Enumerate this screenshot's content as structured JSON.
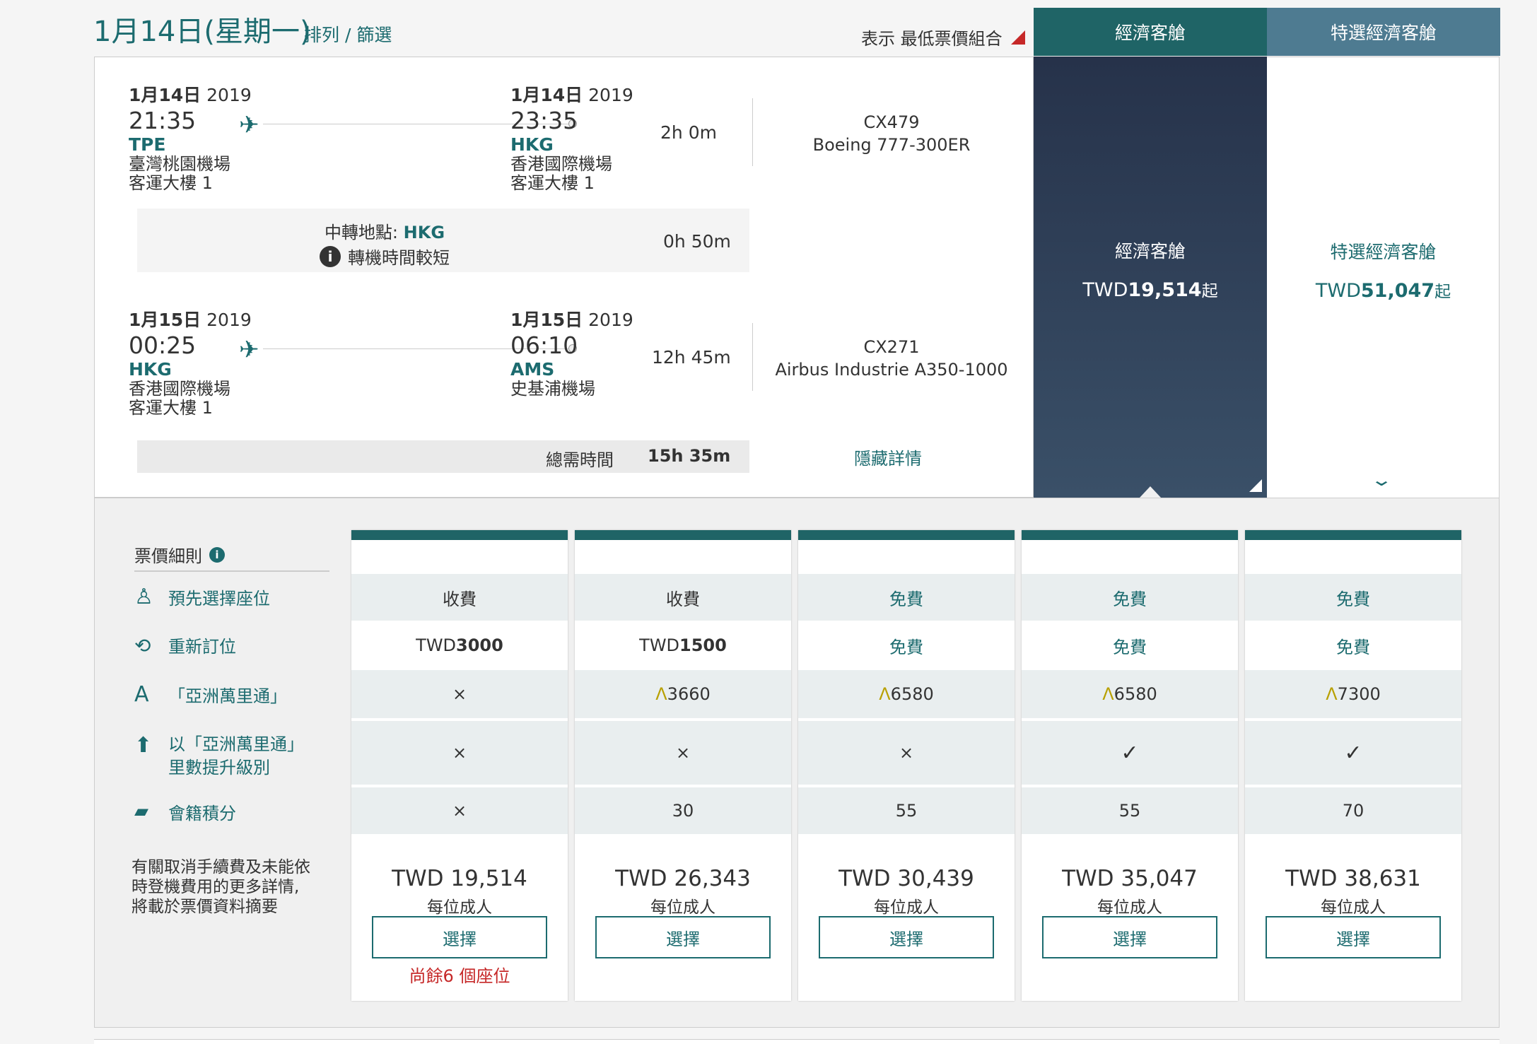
{
  "header": {
    "date_title": "1月14日(星期一)",
    "sort_filter": "排列 / 篩選",
    "lowest_combo": "表示 最低票價組合"
  },
  "cabin_tabs": [
    {
      "label": "經濟客艙"
    },
    {
      "label": "特選經濟客艙"
    }
  ],
  "segments": [
    {
      "dep": {
        "date_md": "1月14日",
        "year": "2019",
        "time": "21:35",
        "code": "TPE",
        "airport": "臺灣桃園機場",
        "terminal": "客運大樓 1"
      },
      "arr": {
        "date_md": "1月14日",
        "year": "2019",
        "time": "23:35",
        "code": "HKG",
        "airport": "香港國際機場",
        "terminal": "客運大樓 1"
      },
      "duration": "2h 0m",
      "flight_no": "CX479",
      "aircraft": "Boeing 777-300ER"
    },
    {
      "dep": {
        "date_md": "1月15日",
        "year": "2019",
        "time": "00:25",
        "code": "HKG",
        "airport": "香港國際機場",
        "terminal": "客運大樓 1"
      },
      "arr": {
        "date_md": "1月15日",
        "year": "2019",
        "time": "06:10",
        "code": "AMS",
        "airport": "史基浦機場",
        "terminal": ""
      },
      "duration": "12h 45m",
      "flight_no": "CX271",
      "aircraft": "Airbus Industrie A350-1000"
    }
  ],
  "transfer": {
    "label": "中轉地點:",
    "code": "HKG",
    "note": "轉機時間較短",
    "duration": "0h 50m"
  },
  "total": {
    "label": "總需時間",
    "value": "15h 35m"
  },
  "hide_details": "隱藏詳情",
  "cabin_prices": [
    {
      "name": "經濟客艙",
      "currency": "TWD",
      "amount": "19,514",
      "suffix": "起"
    },
    {
      "name": "特選經濟客艙",
      "currency": "TWD",
      "amount": "51,047",
      "suffix": "起"
    }
  ],
  "fare_rules": {
    "title": "票價細則",
    "rows": [
      {
        "label": "預先選擇座位",
        "icon": "seat-icon"
      },
      {
        "label": "重新訂位",
        "icon": "rebook-icon"
      },
      {
        "label": "「亞洲萬里通」",
        "icon": "asia-miles-icon"
      },
      {
        "label": "以「亞洲萬里通」",
        "label2": "里數提升級別",
        "icon": "upgrade-icon"
      },
      {
        "label": "會籍積分",
        "icon": "status-points-icon"
      }
    ],
    "note_lines": [
      "有關取消手續費及未能依",
      "時登機費用的更多詳情,",
      "將載於票價資料摘要"
    ]
  },
  "fares": [
    {
      "seat": "收費",
      "rebook_pre": "TWD",
      "rebook": "3000",
      "miles": "×",
      "miles_mark": "",
      "upgrade": "×",
      "points": "×",
      "price": "TWD 19,514",
      "per": "每位成人",
      "button": "選擇",
      "seats_left": "尚餘6 個座位"
    },
    {
      "seat": "收費",
      "rebook_pre": "TWD",
      "rebook": "1500",
      "miles": "3660",
      "miles_mark": "Λ",
      "upgrade": "×",
      "points": "30",
      "price": "TWD 26,343",
      "per": "每位成人",
      "button": "選擇",
      "seats_left": ""
    },
    {
      "seat": "免費",
      "rebook_pre": "",
      "rebook": "免費",
      "miles": "6580",
      "miles_mark": "Λ",
      "upgrade": "×",
      "points": "55",
      "price": "TWD 30,439",
      "per": "每位成人",
      "button": "選擇",
      "seats_left": ""
    },
    {
      "seat": "免費",
      "rebook_pre": "",
      "rebook": "免費",
      "miles": "6580",
      "miles_mark": "Λ",
      "upgrade": "✓",
      "points": "55",
      "price": "TWD 35,047",
      "per": "每位成人",
      "button": "選擇",
      "seats_left": ""
    },
    {
      "seat": "免費",
      "rebook_pre": "",
      "rebook": "免費",
      "miles": "7300",
      "miles_mark": "Λ",
      "upgrade": "✓",
      "points": "70",
      "price": "TWD 38,631",
      "per": "每位成人",
      "button": "選擇",
      "seats_left": ""
    }
  ]
}
